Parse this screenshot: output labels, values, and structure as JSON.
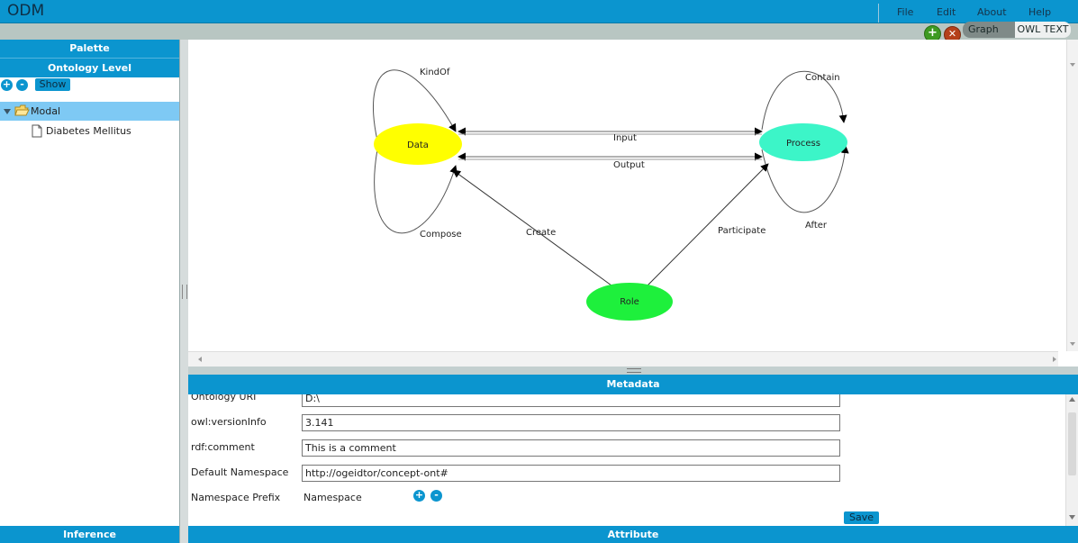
{
  "app": {
    "title": "ODM"
  },
  "menu": {
    "file": "File",
    "edit": "Edit",
    "about": "About",
    "help": "Help"
  },
  "toolbar": {
    "add_icon": "+",
    "remove_icon": "✕",
    "tab_graph": "Graph",
    "tab_owl": "OWL TEXT"
  },
  "left_panel": {
    "palette": "Palette",
    "ontology_level": "Ontology Level",
    "expand_icon": "+",
    "collapse_icon": "-",
    "show_button": "Show",
    "tree": {
      "root": {
        "label": "Modal",
        "expanded": true
      },
      "children": [
        {
          "label": "Diabetes Mellitus"
        }
      ]
    },
    "inference": "Inference"
  },
  "graph": {
    "nodes": {
      "data": {
        "label": "Data",
        "color": "#ffff00"
      },
      "process": {
        "label": "Process",
        "color": "#3cf5c8"
      },
      "role": {
        "label": "Role",
        "color": "#1ef03c"
      }
    },
    "edges": {
      "kindof": "KindOf",
      "compose": "Compose",
      "input": "Input",
      "output": "Output",
      "contain": "Contain",
      "after": "After",
      "create": "Create",
      "participate": "Participate"
    }
  },
  "metadata": {
    "header": "Metadata",
    "fields": [
      {
        "label": "Ontology URI",
        "value": "D:\\"
      },
      {
        "label": "owl:versionInfo",
        "value": "3.141"
      },
      {
        "label": "rdf:comment",
        "value": "This is a comment"
      },
      {
        "label": "Default Namespace",
        "value": "http://ogeidtor/concept-ont#"
      }
    ],
    "prefix_label": "Namespace Prefix",
    "prefix_column": "Namespace",
    "add_icon": "+",
    "remove_icon": "-",
    "save_button": "Save"
  },
  "attribute": {
    "header": "Attribute"
  },
  "colors": {
    "accent": "#0b95cf",
    "selected": "#7ec9f4"
  }
}
